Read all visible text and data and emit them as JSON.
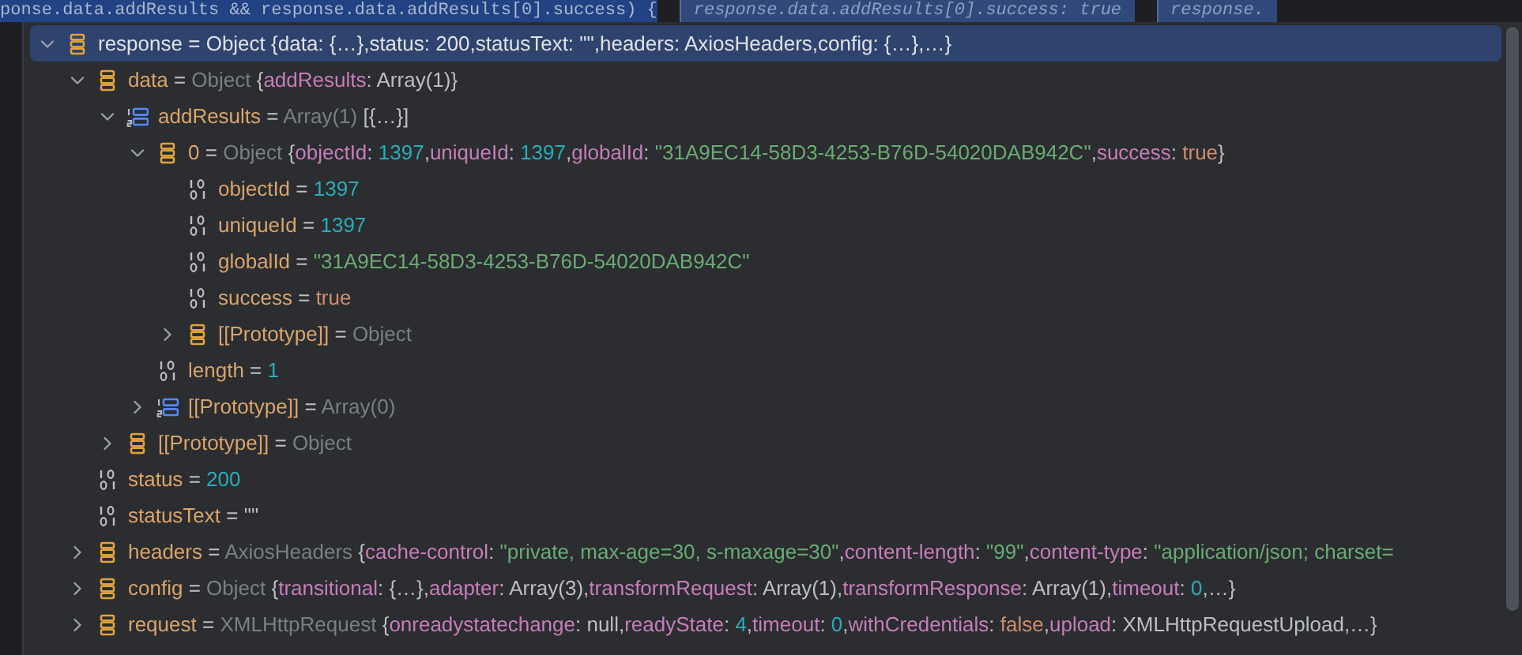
{
  "editor_line": {
    "code": "ponse.data.addResults && response.data.addResults[0].success) {",
    "hints": [
      "response.data.addResults[0].success: true",
      "response."
    ]
  },
  "variables": [
    {
      "name": "response",
      "eq": "=",
      "kind": "object",
      "expanded": true,
      "selected": true,
      "type": "Object",
      "summary": "{data: {…},status: 200,statusText: \"\",headers: AxiosHeaders,config: {…},…}",
      "children": [
        {
          "name": "data",
          "eq": "=",
          "kind": "object",
          "expanded": true,
          "selected": false,
          "type": "Object",
          "preview": [
            {
              "kind": "punct",
              "text": "{"
            },
            {
              "kind": "key",
              "text": "addResults"
            },
            {
              "kind": "punct",
              "text": ": Array(1)}"
            }
          ],
          "children": [
            {
              "name": "addResults",
              "eq": "=",
              "kind": "array",
              "expanded": true,
              "selected": false,
              "type": "Array(1)",
              "preview": [
                {
                  "kind": "punct",
                  "text": "[{…}]"
                }
              ],
              "children": [
                {
                  "name": "0",
                  "eq": "=",
                  "kind": "object",
                  "expanded": true,
                  "selected": false,
                  "type": "Object",
                  "preview": [
                    {
                      "kind": "punct",
                      "text": "{"
                    },
                    {
                      "kind": "key",
                      "text": "objectId"
                    },
                    {
                      "kind": "punct",
                      "text": ": "
                    },
                    {
                      "kind": "number",
                      "text": "1397"
                    },
                    {
                      "kind": "punct",
                      "text": ","
                    },
                    {
                      "kind": "key",
                      "text": "uniqueId"
                    },
                    {
                      "kind": "punct",
                      "text": ": "
                    },
                    {
                      "kind": "number",
                      "text": "1397"
                    },
                    {
                      "kind": "punct",
                      "text": ","
                    },
                    {
                      "kind": "key",
                      "text": "globalId"
                    },
                    {
                      "kind": "punct",
                      "text": ": "
                    },
                    {
                      "kind": "string",
                      "text": "\"31A9EC14-58D3-4253-B76D-54020DAB942C\""
                    },
                    {
                      "kind": "punct",
                      "text": ","
                    },
                    {
                      "kind": "key",
                      "text": "success"
                    },
                    {
                      "kind": "punct",
                      "text": ": "
                    },
                    {
                      "kind": "keyword",
                      "text": "true"
                    },
                    {
                      "kind": "punct",
                      "text": "}"
                    }
                  ],
                  "children": [
                    {
                      "name": "objectId",
                      "eq": "=",
                      "kind": "primitive",
                      "selected": false,
                      "preview": [
                        {
                          "kind": "number",
                          "text": "1397"
                        }
                      ]
                    },
                    {
                      "name": "uniqueId",
                      "eq": "=",
                      "kind": "primitive",
                      "selected": false,
                      "preview": [
                        {
                          "kind": "number",
                          "text": "1397"
                        }
                      ]
                    },
                    {
                      "name": "globalId",
                      "eq": "=",
                      "kind": "primitive",
                      "selected": false,
                      "preview": [
                        {
                          "kind": "string",
                          "text": "\"31A9EC14-58D3-4253-B76D-54020DAB942C\""
                        }
                      ]
                    },
                    {
                      "name": "success",
                      "eq": "=",
                      "kind": "primitive",
                      "selected": false,
                      "preview": [
                        {
                          "kind": "keyword",
                          "text": "true"
                        }
                      ]
                    },
                    {
                      "name": "[[Prototype]]",
                      "eq": "=",
                      "kind": "object",
                      "expanded": false,
                      "selected": false,
                      "type": "Object"
                    }
                  ]
                },
                {
                  "name": "length",
                  "eq": "=",
                  "kind": "primitive",
                  "selected": false,
                  "preview": [
                    {
                      "kind": "number",
                      "text": "1"
                    }
                  ]
                },
                {
                  "name": "[[Prototype]]",
                  "eq": "=",
                  "kind": "array",
                  "expanded": false,
                  "selected": false,
                  "type": "Array(0)"
                }
              ]
            },
            {
              "name": "[[Prototype]]",
              "eq": "=",
              "kind": "object",
              "expanded": false,
              "selected": false,
              "type": "Object"
            }
          ]
        },
        {
          "name": "status",
          "eq": "=",
          "kind": "primitive",
          "selected": false,
          "preview": [
            {
              "kind": "number",
              "text": "200"
            }
          ]
        },
        {
          "name": "statusText",
          "eq": "=",
          "kind": "primitive",
          "selected": false,
          "preview": [
            {
              "kind": "punct",
              "text": "\"\""
            }
          ]
        },
        {
          "name": "headers",
          "eq": "=",
          "kind": "object",
          "expanded": false,
          "selected": false,
          "type": "AxiosHeaders",
          "preview": [
            {
              "kind": "punct",
              "text": "{"
            },
            {
              "kind": "key",
              "text": "cache-control"
            },
            {
              "kind": "punct",
              "text": ": "
            },
            {
              "kind": "string",
              "text": "\"private, max-age=30, s-maxage=30\""
            },
            {
              "kind": "punct",
              "text": ","
            },
            {
              "kind": "key",
              "text": "content-length"
            },
            {
              "kind": "punct",
              "text": ": "
            },
            {
              "kind": "string",
              "text": "\"99\""
            },
            {
              "kind": "punct",
              "text": ","
            },
            {
              "kind": "key",
              "text": "content-type"
            },
            {
              "kind": "punct",
              "text": ": "
            },
            {
              "kind": "string",
              "text": "\"application/json; charset="
            }
          ]
        },
        {
          "name": "config",
          "eq": "=",
          "kind": "object",
          "expanded": false,
          "selected": false,
          "type": "Object",
          "preview": [
            {
              "kind": "punct",
              "text": "{"
            },
            {
              "kind": "key",
              "text": "transitional"
            },
            {
              "kind": "punct",
              "text": ": {…},"
            },
            {
              "kind": "key",
              "text": "adapter"
            },
            {
              "kind": "punct",
              "text": ": Array(3),"
            },
            {
              "kind": "key",
              "text": "transformRequest"
            },
            {
              "kind": "punct",
              "text": ": Array(1),"
            },
            {
              "kind": "key",
              "text": "transformResponse"
            },
            {
              "kind": "punct",
              "text": ": Array(1),"
            },
            {
              "kind": "key",
              "text": "timeout"
            },
            {
              "kind": "punct",
              "text": ": "
            },
            {
              "kind": "number",
              "text": "0"
            },
            {
              "kind": "punct",
              "text": ",…}"
            }
          ]
        },
        {
          "name": "request",
          "eq": "=",
          "kind": "object",
          "expanded": false,
          "selected": false,
          "type": "XMLHttpRequest",
          "preview": [
            {
              "kind": "punct",
              "text": "{"
            },
            {
              "kind": "key",
              "text": "onreadystatechange"
            },
            {
              "kind": "punct",
              "text": ": null,"
            },
            {
              "kind": "key",
              "text": "readyState"
            },
            {
              "kind": "punct",
              "text": ": "
            },
            {
              "kind": "number",
              "text": "4"
            },
            {
              "kind": "punct",
              "text": ","
            },
            {
              "kind": "key",
              "text": "timeout"
            },
            {
              "kind": "punct",
              "text": ": "
            },
            {
              "kind": "number",
              "text": "0"
            },
            {
              "kind": "punct",
              "text": ","
            },
            {
              "kind": "key",
              "text": "withCredentials"
            },
            {
              "kind": "punct",
              "text": ": "
            },
            {
              "kind": "keyword",
              "text": "false"
            },
            {
              "kind": "punct",
              "text": ","
            },
            {
              "kind": "key",
              "text": "upload"
            },
            {
              "kind": "punct",
              "text": ": XMLHttpRequestUpload,…}"
            }
          ]
        }
      ]
    }
  ]
}
